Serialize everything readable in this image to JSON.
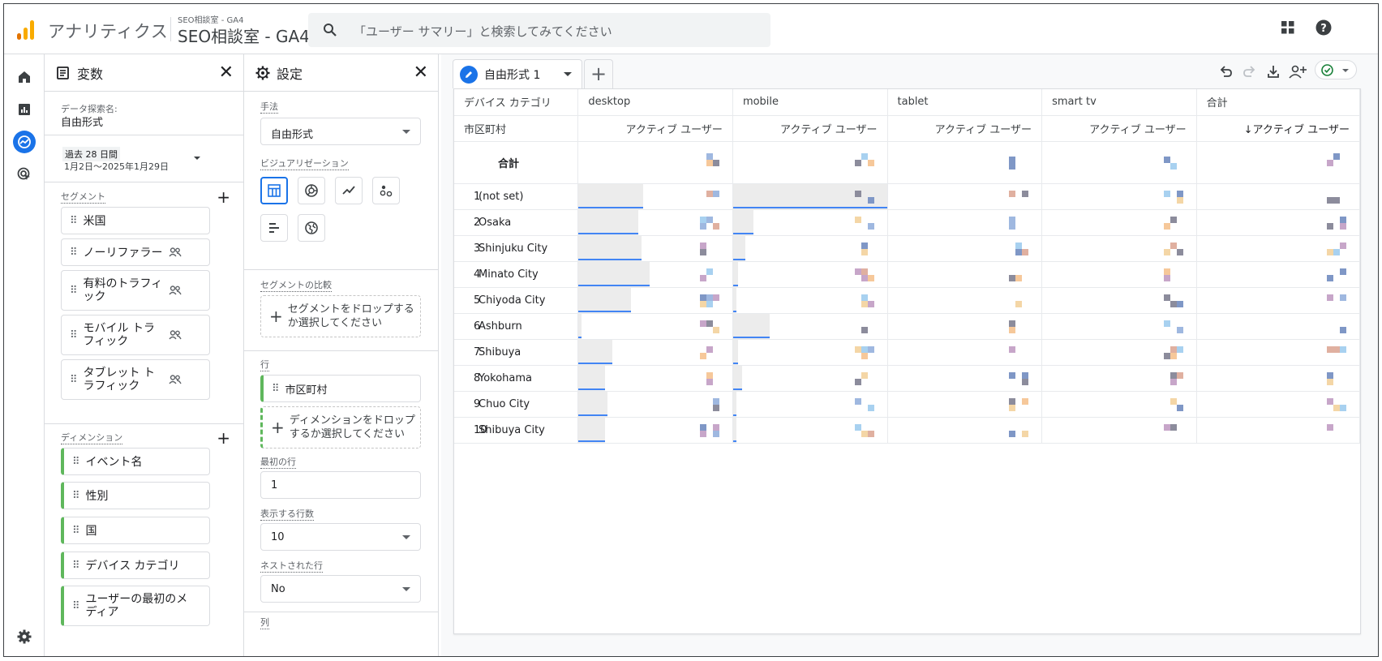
{
  "header": {
    "app_name": "アナリティクス",
    "property_sub": "SEO相談室 - GA4",
    "property_main": "SEO相談室 - GA4",
    "search_placeholder": "「ユーザー サマリー」と検索してみてください",
    "icons": [
      "apps-icon",
      "help-icon"
    ]
  },
  "rail": {
    "items": [
      "home-icon",
      "reports-icon",
      "explore-icon",
      "advertising-icon"
    ],
    "bottom": "settings-icon"
  },
  "variables": {
    "title": "変数",
    "exploration_name_label": "データ探索名:",
    "exploration_name": "自由形式",
    "date_badge": "過去 28 日間",
    "date_range": "1月2日～2025年1月29日",
    "segments_label": "セグメント",
    "segments": [
      {
        "label": "米国",
        "shared": false
      },
      {
        "label": "ノーリファラー",
        "shared": true
      },
      {
        "label": "有料のトラフィック",
        "shared": true
      },
      {
        "label": "モバイル トラフィック",
        "shared": true
      },
      {
        "label": "タブレット トラフィック",
        "shared": true
      }
    ],
    "dimensions_label": "ディメンション",
    "dimensions": [
      "イベント名",
      "性別",
      "国",
      "デバイス カテゴリ",
      "ユーザーの最初のメディア"
    ]
  },
  "settings": {
    "title": "設定",
    "technique_label": "手法",
    "technique_value": "自由形式",
    "visualization_label": "ビジュアリゼーション",
    "visualizations": [
      "table-icon",
      "donut-chart-icon",
      "line-chart-icon",
      "scatter-icon",
      "bar-chart-icon",
      "geo-map-icon"
    ],
    "segment_compare_label": "セグメントの比較",
    "segment_drop_text": "セグメントをドロップするか選択してください",
    "rows_label": "行",
    "row_chip": "市区町村",
    "row_drop_text": "ディメンションをドロップするか選択してください",
    "first_row_label": "最初の行",
    "first_row_value": "1",
    "show_rows_label": "表示する行数",
    "show_rows_value": "10",
    "nested_rows_label": "ネストされた行",
    "nested_rows_value": "No",
    "columns_label": "列"
  },
  "workspace": {
    "tab_label": "自由形式 1",
    "tools": [
      "undo-icon",
      "redo-icon",
      "download-icon",
      "share-icon",
      "status-check-icon"
    ]
  },
  "table": {
    "dimension_header": "デバイス カテゴリ",
    "row_dimension_header": "市区町村",
    "columns": [
      "desktop",
      "mobile",
      "tablet",
      "smart tv",
      "合計"
    ],
    "metric_headers": [
      "アクティブ ユーザー",
      "アクティブ ユーザー",
      "アクティブ ユーザー",
      "アクティブ ユーザー",
      "↓アクティブ ユーザー"
    ],
    "total_label": "合計",
    "rows": [
      {
        "num": "1",
        "city": "(not set)",
        "desktop": 0.42,
        "mobile": 1.0
      },
      {
        "num": "2",
        "city": "Osaka",
        "desktop": 0.39,
        "mobile": 0.13
      },
      {
        "num": "3",
        "city": "Shinjuku City",
        "desktop": 0.41,
        "mobile": 0.08
      },
      {
        "num": "4",
        "city": "Minato City",
        "desktop": 0.46,
        "mobile": 0.03
      },
      {
        "num": "5",
        "city": "Chiyoda City",
        "desktop": 0.34,
        "mobile": 0.02
      },
      {
        "num": "6",
        "city": "Ashburn",
        "desktop": 0.02,
        "mobile": 0.24
      },
      {
        "num": "7",
        "city": "Shibuya",
        "desktop": 0.22,
        "mobile": 0.03
      },
      {
        "num": "8",
        "city": "Yokohama",
        "desktop": 0.17,
        "mobile": 0.06
      },
      {
        "num": "9",
        "city": "Chuo City",
        "desktop": 0.19,
        "mobile": 0.02
      },
      {
        "num": "10",
        "city": "Shibuya City",
        "desktop": 0.17,
        "mobile": 0.02
      }
    ]
  },
  "colors": {
    "accent": "#1a73e8",
    "bar": "#4285f4",
    "chip_green": "#5fb75c",
    "logo_orange": "#f9ab00",
    "logo_dark": "#e37400"
  }
}
